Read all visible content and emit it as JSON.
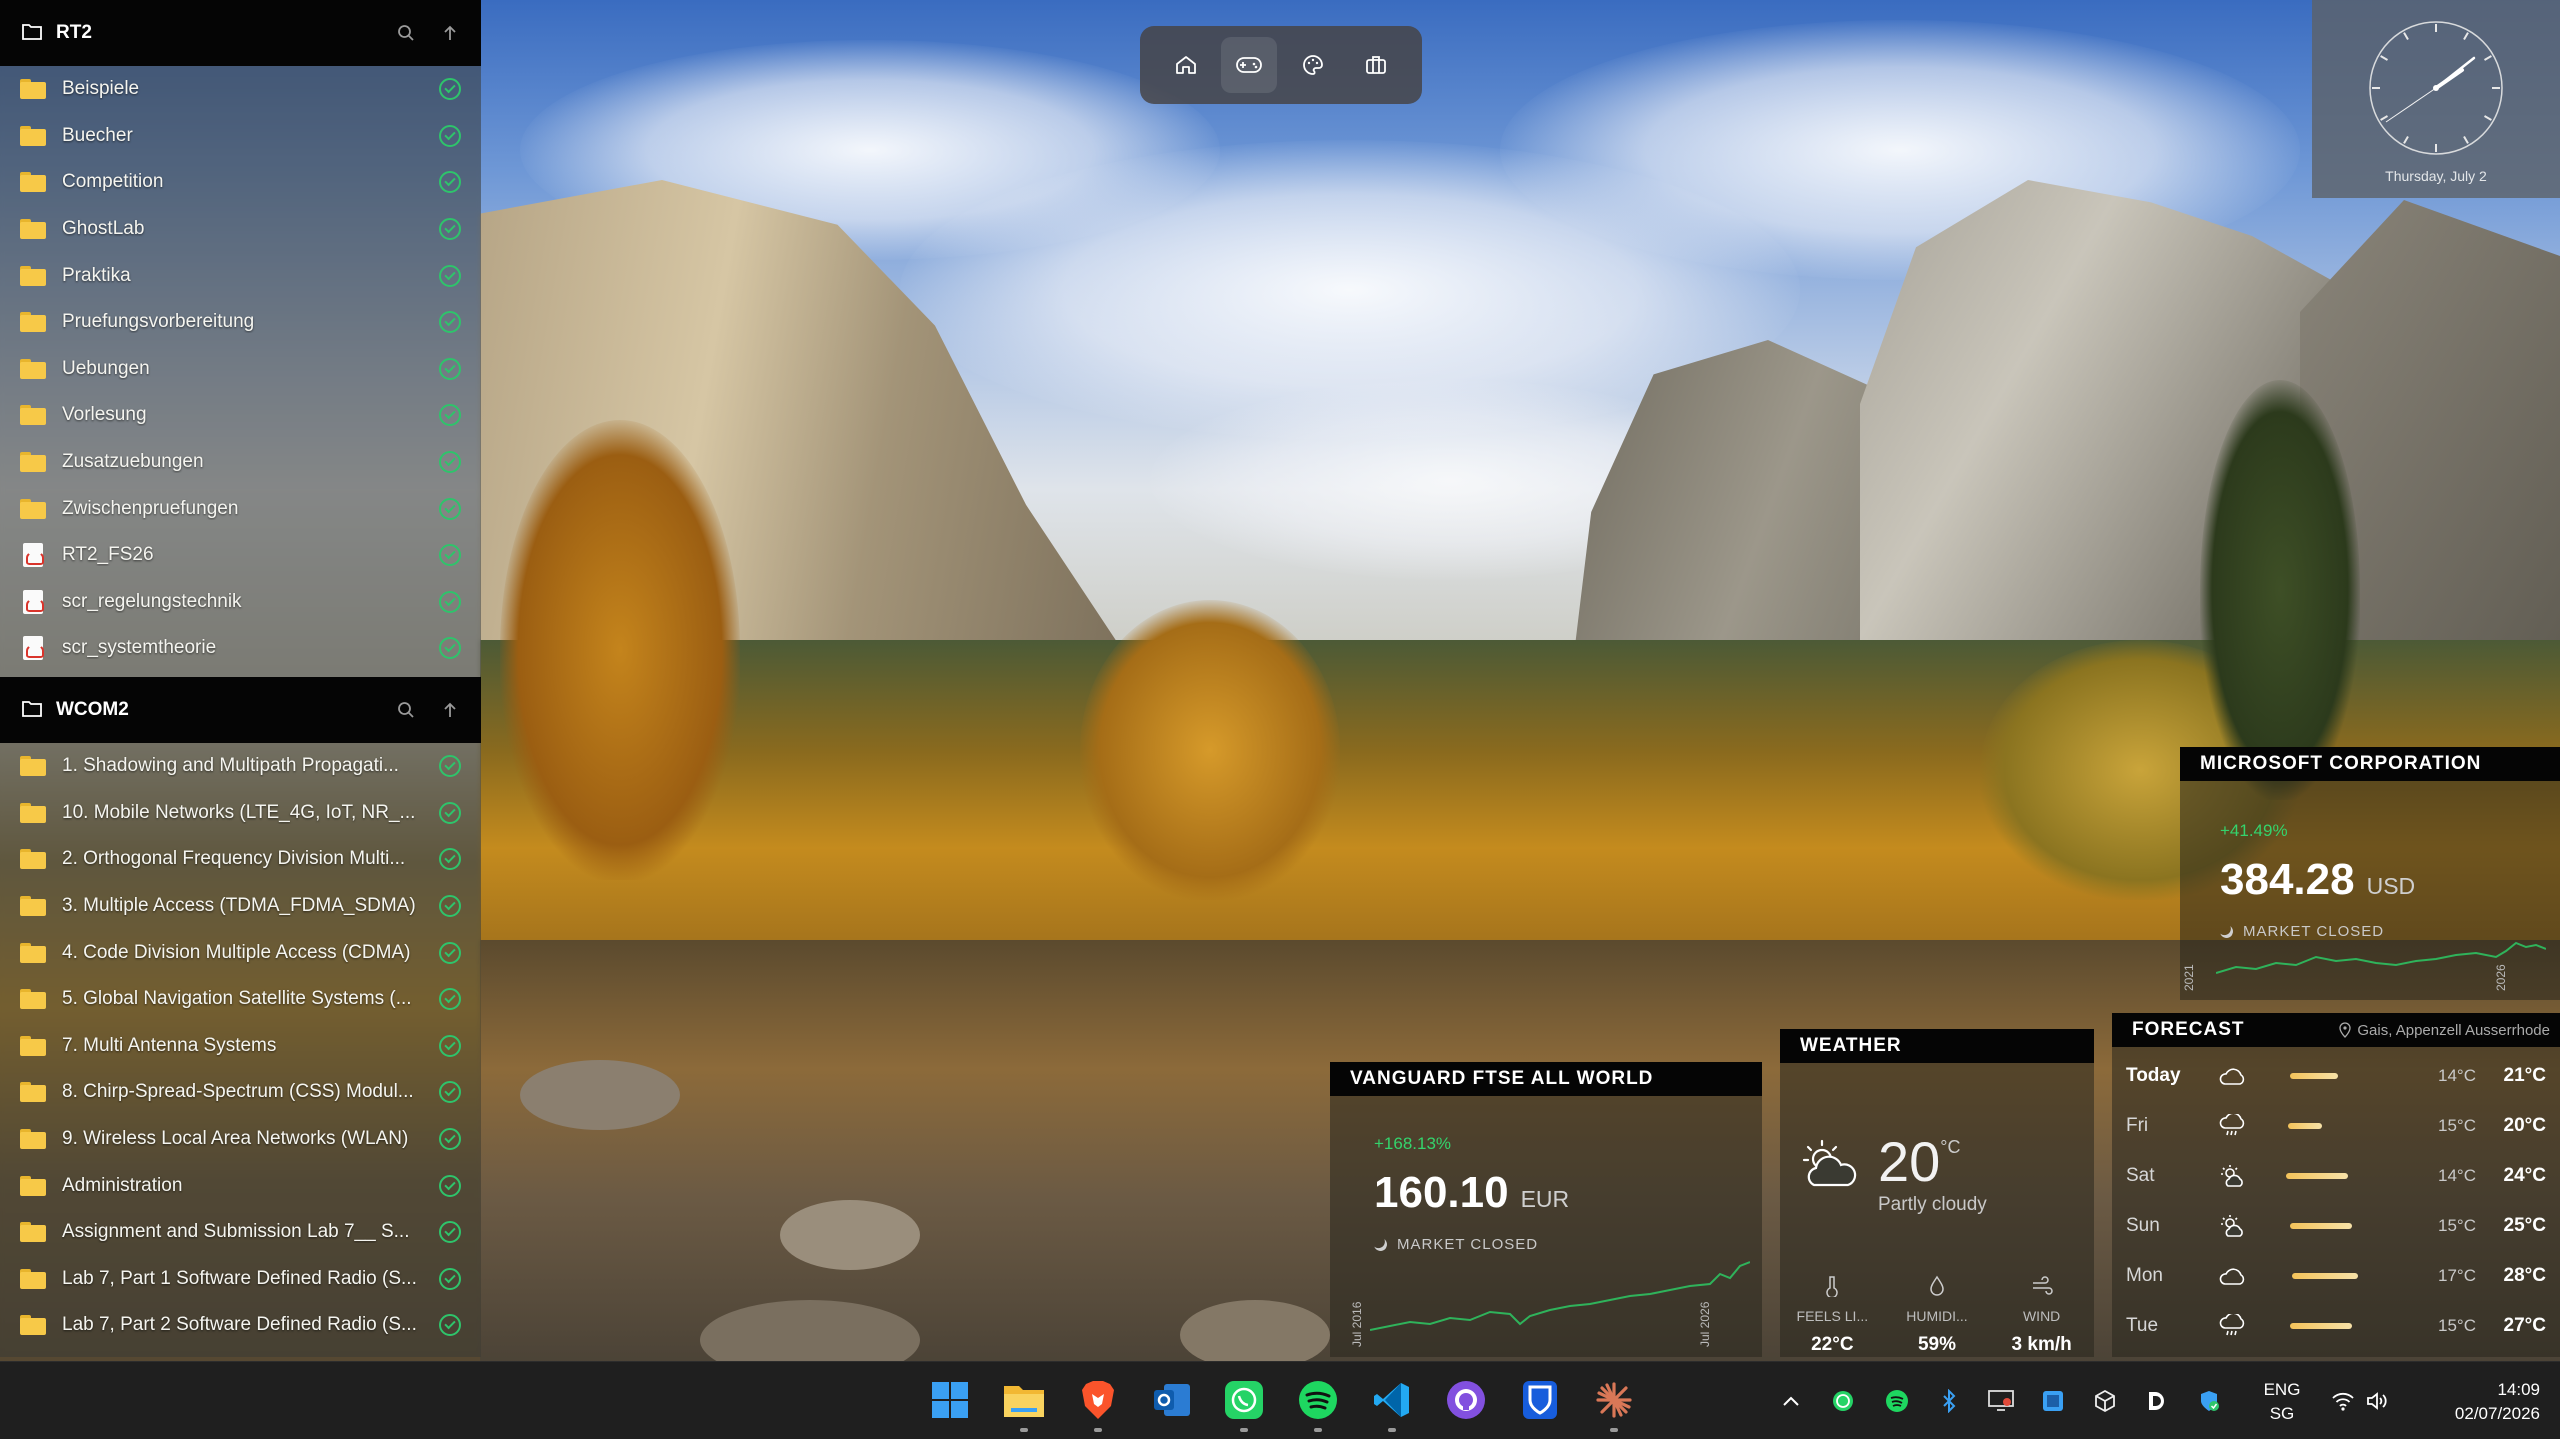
{
  "panels": [
    {
      "title": "RT2",
      "items": [
        {
          "label": "Beispiele",
          "type": "folder"
        },
        {
          "label": "Buecher",
          "type": "folder"
        },
        {
          "label": "Competition",
          "type": "folder"
        },
        {
          "label": "GhostLab",
          "type": "folder"
        },
        {
          "label": "Praktika",
          "type": "folder"
        },
        {
          "label": "Pruefungsvorbereitung",
          "type": "folder"
        },
        {
          "label": "Uebungen",
          "type": "folder"
        },
        {
          "label": "Vorlesung",
          "type": "folder"
        },
        {
          "label": "Zusatzuebungen",
          "type": "folder"
        },
        {
          "label": "Zwischenpruefungen",
          "type": "folder"
        },
        {
          "label": "RT2_FS26",
          "type": "pdf"
        },
        {
          "label": "scr_regelungstechnik",
          "type": "pdf"
        },
        {
          "label": "scr_systemtheorie",
          "type": "pdf"
        }
      ]
    },
    {
      "title": "WCOM2",
      "items": [
        {
          "label": "1. Shadowing and Multipath Propagati...",
          "type": "folder"
        },
        {
          "label": "10. Mobile Networks (LTE_4G, IoT, NR_...",
          "type": "folder"
        },
        {
          "label": "2. Orthogonal Frequency Division Multi...",
          "type": "folder"
        },
        {
          "label": "3. Multiple Access (TDMA_FDMA_SDMA)",
          "type": "folder"
        },
        {
          "label": "4. Code Division Multiple Access (CDMA)",
          "type": "folder"
        },
        {
          "label": "5. Global Navigation Satellite Systems (...",
          "type": "folder"
        },
        {
          "label": "7. Multi Antenna Systems",
          "type": "folder"
        },
        {
          "label": "8. Chirp-Spread-Spectrum (CSS) Modul...",
          "type": "folder"
        },
        {
          "label": "9. Wireless Local Area Networks (WLAN)",
          "type": "folder"
        },
        {
          "label": "Administration",
          "type": "folder"
        },
        {
          "label": "Assignment and Submission Lab 7__ S...",
          "type": "folder"
        },
        {
          "label": "Lab 7, Part 1 Software Defined Radio (S...",
          "type": "folder"
        },
        {
          "label": "Lab 7, Part 2 Software Defined Radio (S...",
          "type": "folder"
        }
      ]
    }
  ],
  "topbar": {
    "icons": [
      "home-icon",
      "gamepad-icon",
      "palette-icon",
      "briefcase-icon"
    ]
  },
  "clock": {
    "date": "Thursday, July 2"
  },
  "stocks": {
    "msft": {
      "title": "MICROSOFT CORPORATION",
      "change": "+41.49%",
      "price": "384.28",
      "currency": "USD",
      "status": "MARKET CLOSED",
      "axis_start": "2021",
      "axis_end": "2026"
    },
    "vanguard": {
      "title": "VANGUARD FTSE ALL WORLD",
      "change": "+168.13%",
      "price": "160.10",
      "currency": "EUR",
      "status": "MARKET CLOSED",
      "axis_start": "Jul 2016",
      "axis_end": "Jul 2026"
    }
  },
  "weather": {
    "title": "WEATHER",
    "temp": "20",
    "temp_unit": "°C",
    "condition": "Partly cloudy",
    "feels_label": "FEELS LI...",
    "feels_value": "22°C",
    "humidity_label": "HUMIDI...",
    "humidity_value": "59%",
    "wind_label": "WIND",
    "wind_value": "3 km/h"
  },
  "forecast": {
    "title": "FORECAST",
    "location": "Gais, Appenzell Ausserrhode",
    "days": [
      {
        "day": "Today",
        "lo": "14°C",
        "hi": "21°C",
        "icon": "cloud-icon"
      },
      {
        "day": "Fri",
        "lo": "15°C",
        "hi": "20°C",
        "icon": "rain-icon"
      },
      {
        "day": "Sat",
        "lo": "14°C",
        "hi": "24°C",
        "icon": "sun-cloud-icon"
      },
      {
        "day": "Sun",
        "lo": "15°C",
        "hi": "25°C",
        "icon": "sun-cloud-icon"
      },
      {
        "day": "Mon",
        "lo": "17°C",
        "hi": "28°C",
        "icon": "cloud-icon"
      },
      {
        "day": "Tue",
        "lo": "15°C",
        "hi": "27°C",
        "icon": "rain-icon"
      }
    ]
  },
  "taskbar": {
    "language": "ENG",
    "region": "SG",
    "time": "14:09",
    "date": "02/07/2026"
  },
  "colors": {
    "accent_green": "#2ec46b",
    "folder": "#f7c948",
    "panel_head": "#050505"
  }
}
